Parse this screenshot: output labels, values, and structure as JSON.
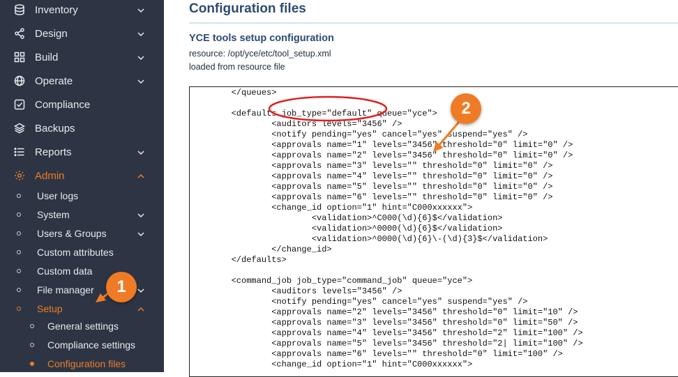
{
  "sidebar": {
    "items": [
      {
        "label": "Inventory",
        "icon": "database-icon",
        "has_chevron": true
      },
      {
        "label": "Design",
        "icon": "share-icon",
        "has_chevron": true
      },
      {
        "label": "Build",
        "icon": "grid-icon",
        "has_chevron": true
      },
      {
        "label": "Operate",
        "icon": "globe-icon",
        "has_chevron": true
      },
      {
        "label": "Compliance",
        "icon": "checkbox-icon",
        "has_chevron": false
      },
      {
        "label": "Backups",
        "icon": "layers-icon",
        "has_chevron": false
      },
      {
        "label": "Reports",
        "icon": "list-icon",
        "has_chevron": true
      },
      {
        "label": "Admin",
        "icon": "gear-icon",
        "has_chevron": true,
        "active": true
      }
    ],
    "admin_children": [
      {
        "label": "User logs"
      },
      {
        "label": "System"
      },
      {
        "label": "Users & Groups"
      },
      {
        "label": "Custom attributes"
      },
      {
        "label": "Custom data"
      },
      {
        "label": "File manager"
      },
      {
        "label": "Setup"
      }
    ],
    "setup_children": [
      {
        "label": "General settings"
      },
      {
        "label": "Compliance settings"
      },
      {
        "label": "Configuration files"
      }
    ]
  },
  "main": {
    "title": "Configuration files",
    "section_title": "YCE tools setup configuration",
    "resource_line": "resource: /opt/yce/etc/tool_setup.xml",
    "loaded_line": "loaded from resource file",
    "code": "        </queues>\n\n        <defaults job_type=\"default\" queue=\"yce\">\n                <auditors levels=\"3456\" />\n                <notify pending=\"yes\" cancel=\"yes\" suspend=\"yes\" />\n                <approvals name=\"1\" levels=\"3456\" threshold=\"0\" limit=\"0\" />\n                <approvals name=\"2\" levels=\"3456\" threshold=\"0\" limit=\"0\" />\n                <approvals name=\"3\" levels=\"\" threshold=\"0\" limit=\"0\" />\n                <approvals name=\"4\" levels=\"\" threshold=\"0\" limit=\"0\" />\n                <approvals name=\"5\" levels=\"\" threshold=\"0\" limit=\"0\" />\n                <approvals name=\"6\" levels=\"\" threshold=\"0\" limit=\"0\" />\n                <change_id option=\"1\" hint=\"C000xxxxxx\">\n                        <validation>^C000(\\d){6}$</validation>\n                        <validation>^0000(\\d){6}$</validation>\n                        <validation>^0000(\\d){6}\\-(\\d){3}$</validation>\n                </change_id>\n        </defaults>\n\n        <command_job job_type=\"command_job\" queue=\"yce\">\n                <auditors levels=\"3456\" />\n                <notify pending=\"yes\" cancel=\"yes\" suspend=\"yes\" />\n                <approvals name=\"2\" levels=\"3456\" threshold=\"0\" limit=\"10\" />\n                <approvals name=\"3\" levels=\"3456\" threshold=\"0\" limit=\"50\" />\n                <approvals name=\"4\" levels=\"3456\" threshold=\"2\" limit=\"100\" />\n                <approvals name=\"5\" levels=\"3456\" threshold=\"2| limit=\"100\" />\n                <approvals name=\"6\" levels=\"\" threshold=\"0\" limit=\"100\" />\n                <change_id option=\"1\" hint=\"C000xxxxxx\">"
  },
  "annotations": {
    "badge1": "1",
    "badge2": "2",
    "accent_color": "#f07b26",
    "highlight_color": "#e02020"
  }
}
